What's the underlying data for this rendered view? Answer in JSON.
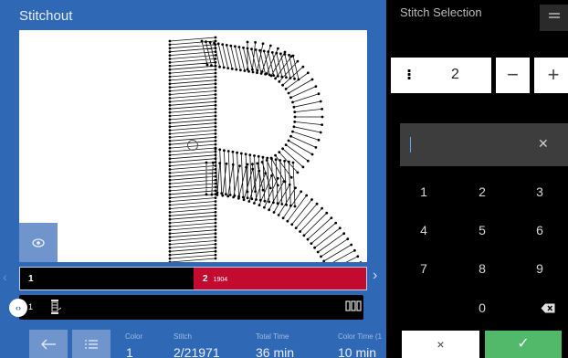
{
  "app": {
    "title": "Stitchout"
  },
  "stitch_selection": {
    "title": "Stitch Selection",
    "step_value": "2",
    "minus_label": "−",
    "plus_label": "+",
    "entry_value": "",
    "keypad": [
      "1",
      "2",
      "3",
      "4",
      "5",
      "6",
      "7",
      "8",
      "9",
      "0"
    ],
    "cancel_label": "×",
    "confirm_label": "✓"
  },
  "color_bar": {
    "segments": [
      {
        "label": "1",
        "count": "",
        "color": "#000000"
      },
      {
        "label": "2",
        "count": "1904",
        "color": "#c30b2f"
      }
    ]
  },
  "thread_bar": {
    "index": "1"
  },
  "info": {
    "color": {
      "label": "Color",
      "value": "1"
    },
    "stitch": {
      "label": "Stitch",
      "value": "2/21971"
    },
    "total_time": {
      "label": "Total Time",
      "value": "36 min"
    },
    "color_time": {
      "label": "Color Time (1",
      "value": "10 min"
    }
  },
  "icons": {
    "eye": "eye-icon",
    "back": "arrow-left-icon",
    "list": "list-icon",
    "menu": "hamburger-menu-icon",
    "backspace": "backspace-icon",
    "spool": "thread-spool-icon"
  },
  "colors": {
    "accent": "#2f68b4",
    "stitch_red": "#c30b2f",
    "confirm_green": "#52b96b"
  }
}
